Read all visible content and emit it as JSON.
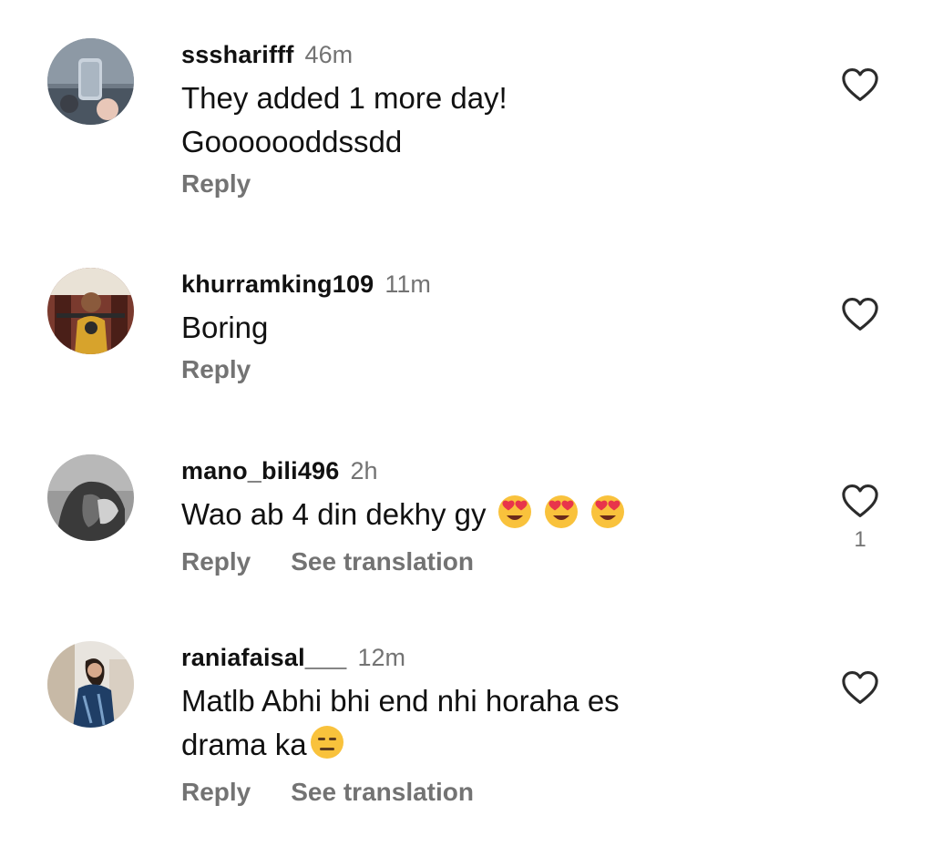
{
  "comments": [
    {
      "username": "sssharifff",
      "time": "46m",
      "text": "They added 1 more day!\nGooooooddssdd",
      "actions": {
        "reply": "Reply"
      },
      "likes": ""
    },
    {
      "username": "khurramking109",
      "time": "11m",
      "text": "Boring",
      "actions": {
        "reply": "Reply"
      },
      "likes": ""
    },
    {
      "username": "mano_bili496",
      "time": "2h",
      "text": "Wao ab 4 din dekhy gy",
      "emojis": [
        "heart-eyes-emoji",
        "heart-eyes-emoji",
        "heart-eyes-emoji"
      ],
      "actions": {
        "reply": "Reply",
        "translate": "See translation"
      },
      "likes": "1"
    },
    {
      "username": "raniafaisal___",
      "time": "12m",
      "text": "Matlb Abhi bhi end nhi horaha es\ndrama ka",
      "emojis": [
        "expressionless-emoji"
      ],
      "actions": {
        "reply": "Reply",
        "translate": "See translation"
      },
      "likes": ""
    }
  ],
  "icons": {
    "like": "heart-outline-icon"
  },
  "colors": {
    "username": "#111111",
    "muted": "#737373",
    "emoji_face": "#f9c23c",
    "emoji_heart": "#e8354b"
  }
}
